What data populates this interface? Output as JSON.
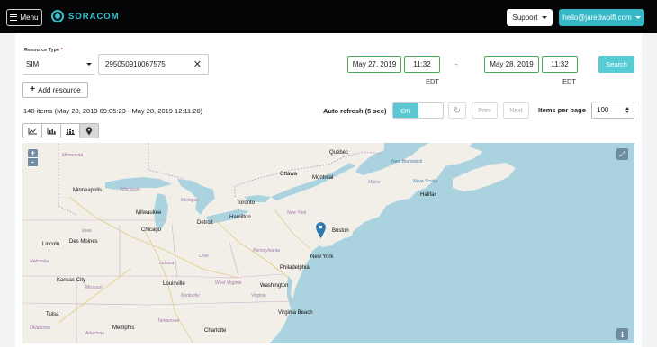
{
  "header": {
    "menu_label": "Menu",
    "brand": "SORACOM",
    "support_label": "Support",
    "account_label": "hello@jaredwolff.com"
  },
  "filters": {
    "resource_type_label": "Resource Type",
    "resource_type_required": "*",
    "resource_type_value": "SIM",
    "resource_id_value": "295050910067575",
    "from_date": "May 27, 2019",
    "from_time": "11:32",
    "from_tz": "EDT",
    "range_separator": "-",
    "to_date": "May 28, 2019",
    "to_time": "11:32",
    "to_tz": "EDT",
    "search_label": "Search"
  },
  "actions": {
    "add_resource_label": "Add resource"
  },
  "results": {
    "summary": "140 items (May 28, 2019 09:05:23 - May 28, 2019 12:11:20)",
    "auto_refresh_label": "Auto refresh (5 sec)",
    "auto_refresh_state": "ON",
    "prev_label": "Prev",
    "next_label": "Next",
    "items_per_page_label": "Items per page",
    "items_per_page_value": "100"
  },
  "view_modes": [
    {
      "icon": "line-chart-icon",
      "active": false
    },
    {
      "icon": "bar-chart-icon",
      "active": false
    },
    {
      "icon": "stacked-chart-icon",
      "active": false
    },
    {
      "icon": "map-marker-icon",
      "active": true
    }
  ],
  "map": {
    "zoom_in": "+",
    "zoom_out": "-",
    "info": "i",
    "cities": [
      "Québec",
      "Ottawa",
      "Montréal",
      "Minneapolis",
      "Toronto",
      "Halifax",
      "Milwaukee",
      "Hamilton",
      "Detroit",
      "Chicago",
      "Boston",
      "Lincoln",
      "Des Moines",
      "New York",
      "Philadelphia",
      "Kansas City",
      "Louisville",
      "Washington",
      "Tulsa",
      "Virginia Beach",
      "Memphis",
      "Charlotte"
    ],
    "regions": [
      "Minnesota",
      "New Brunswick",
      "Nova Scotia",
      "Maine",
      "Wisconsin",
      "Michigan",
      "New York",
      "Iowa",
      "Ohio",
      "Pennsylvania",
      "Nebraska",
      "Indiana",
      "Missouri",
      "West Virginia",
      "Virginia",
      "Kentucky",
      "Tennessee",
      "Oklahoma",
      "Arkansas"
    ]
  },
  "colors": {
    "topbar": "#030507",
    "accent": "#34b8c6",
    "toggle_on": "#5ac7d2",
    "date_border": "#4aa85a",
    "map_land": "#f2efe9",
    "map_water": "#aad3df",
    "marker": "#2b7bb9"
  }
}
